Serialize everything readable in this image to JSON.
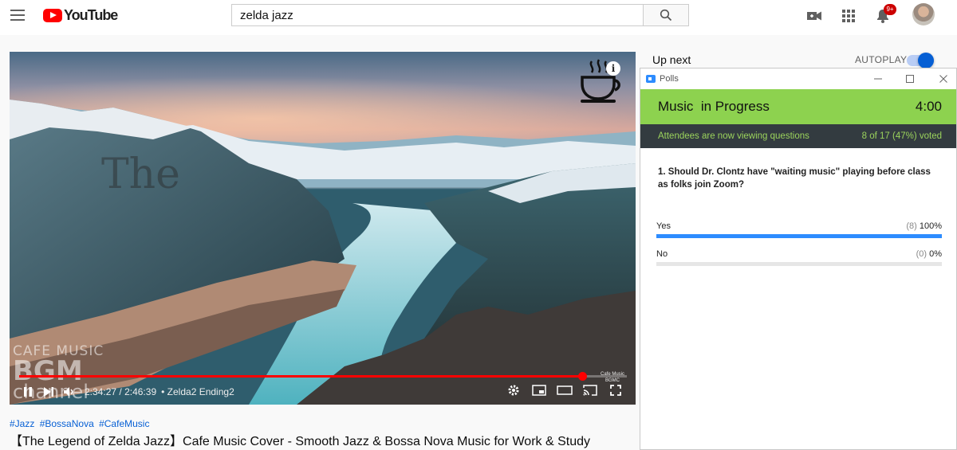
{
  "header": {
    "logo_text": "YouTube",
    "search_query": "zelda jazz",
    "notification_count": "9+"
  },
  "video": {
    "overlay_text": "The",
    "watermark_line1": "CAFE MUSIC",
    "watermark_line2": "BGM",
    "watermark_line3": "channel",
    "small_logo_text": "Cafe Music BGMC",
    "current_time": "2:34:27",
    "duration": "2:46:39",
    "time_separator": "/",
    "chapter_separator": "•",
    "chapter": "Zelda2 Ending2",
    "progress_fraction": 0.927
  },
  "hashtags": [
    "#Jazz",
    "#BossaNova",
    "#CafeMusic"
  ],
  "title": "【The Legend of Zelda Jazz】Cafe Music Cover - Smooth Jazz & Bossa Nova Music for Work & Study",
  "sidebar": {
    "up_next_label": "Up next",
    "autoplay_label": "AUTOPLAY",
    "autoplay_on": true
  },
  "polls": {
    "window_title": "Polls",
    "poll_name": "Music  in Progress",
    "timer": "4:00",
    "status_left": "Attendees are now viewing questions",
    "status_right": "8 of 17 (47%) voted",
    "question": "1. Should Dr. Clontz have \"waiting music\" playing before class as folks join Zoom?",
    "answers": [
      {
        "label": "Yes",
        "count": "(8)",
        "percent": "100%",
        "fraction": 1.0
      },
      {
        "label": "No",
        "count": "(0)",
        "percent": "0%",
        "fraction": 0.0
      }
    ],
    "accent_color": "#8dd24f",
    "bar_color": "#2d8cff"
  },
  "colors": {
    "youtube_red": "#ff0000",
    "link_blue": "#065fd4"
  }
}
